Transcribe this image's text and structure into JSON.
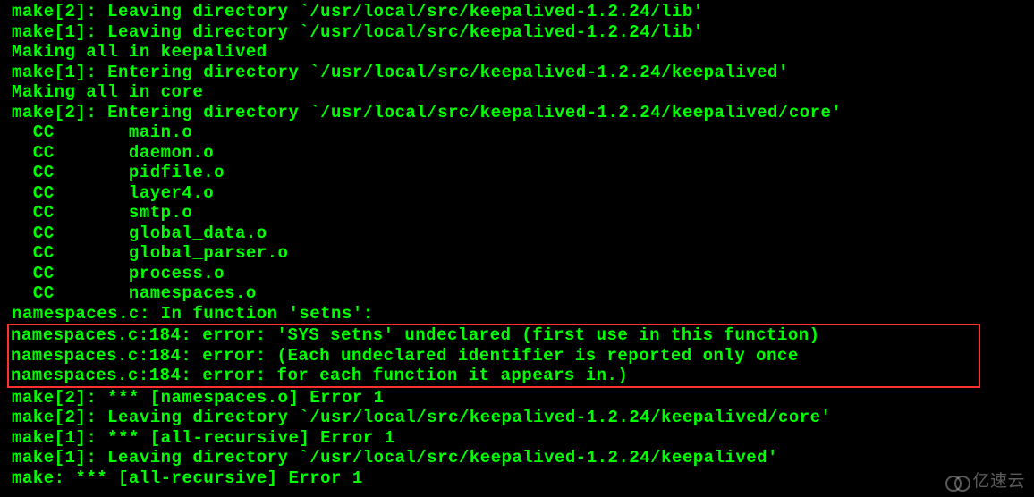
{
  "lines": {
    "l1": "make[2]: Leaving directory `/usr/local/src/keepalived-1.2.24/lib'",
    "l2": "make[1]: Leaving directory `/usr/local/src/keepalived-1.2.24/lib'",
    "l3": "Making all in keepalived",
    "l4": "make[1]: Entering directory `/usr/local/src/keepalived-1.2.24/keepalived'",
    "l5": "Making all in core",
    "l6": "make[2]: Entering directory `/usr/local/src/keepalived-1.2.24/keepalived/core'",
    "l7": "  CC       main.o",
    "l8": "  CC       daemon.o",
    "l9": "  CC       pidfile.o",
    "l10": "  CC       layer4.o",
    "l11": "  CC       smtp.o",
    "l12": "  CC       global_data.o",
    "l13": "  CC       global_parser.o",
    "l14": "  CC       process.o",
    "l15": "  CC       namespaces.o",
    "l16": "namespaces.c: In function 'setns':",
    "e1": "namespaces.c:184: error: 'SYS_setns' undeclared (first use in this function)",
    "e2": "namespaces.c:184: error: (Each undeclared identifier is reported only once",
    "e3": "namespaces.c:184: error: for each function it appears in.)",
    "l17": "make[2]: *** [namespaces.o] Error 1",
    "l18": "make[2]: Leaving directory `/usr/local/src/keepalived-1.2.24/keepalived/core'",
    "l19": "make[1]: *** [all-recursive] Error 1",
    "l20": "make[1]: Leaving directory `/usr/local/src/keepalived-1.2.24/keepalived'",
    "l21": "make: *** [all-recursive] Error 1"
  },
  "watermark": {
    "text": "亿速云"
  }
}
